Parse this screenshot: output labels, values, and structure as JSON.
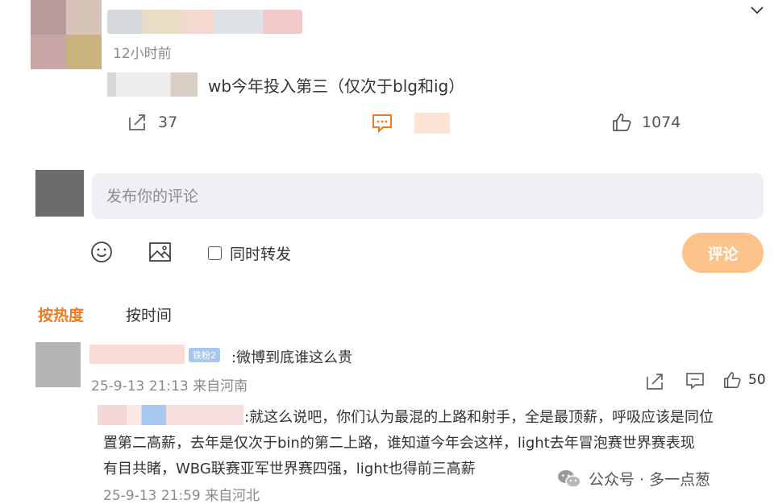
{
  "post": {
    "time": "12小时前",
    "text": "wb今年投入第三（仅次于blg和ig）",
    "repost_count": "37",
    "like_count": "1074"
  },
  "compose": {
    "placeholder": "发布你的评论",
    "repost_label": "同时转发",
    "submit_label": "评论"
  },
  "sort_tabs": {
    "hot": "按热度",
    "time": "按时间"
  },
  "comments": [
    {
      "badge": "铁粉2",
      "text": ":微博到底谁这么贵",
      "meta": "25-9-13 21:13 来自河南",
      "like_count": "50",
      "reply": {
        "line1": ":就这么说吧，你们认为最混的上路和射手，全是最顶薪，呼吸应该是同位",
        "line2": "置第二高薪，去年是仅次于bin的第二上路，谁知道今年会这样，light去年冒泡赛世界赛表现",
        "line3": "有目共睹，WBG联赛亚军世界赛四强，light也得前三高薪",
        "meta": "25-9-13 21:59 来自河北"
      }
    }
  ],
  "watermark": {
    "text": "公众号 · 多一点葱"
  },
  "colors": {
    "accent_orange": "#f07a1f",
    "submit_bg": "#fcc38b",
    "input_bg": "#eef0f3"
  },
  "icons": [
    "chevron-down-icon",
    "repost-icon",
    "comment-icon",
    "like-icon",
    "emoji-icon",
    "image-icon",
    "wechat-icon"
  ]
}
